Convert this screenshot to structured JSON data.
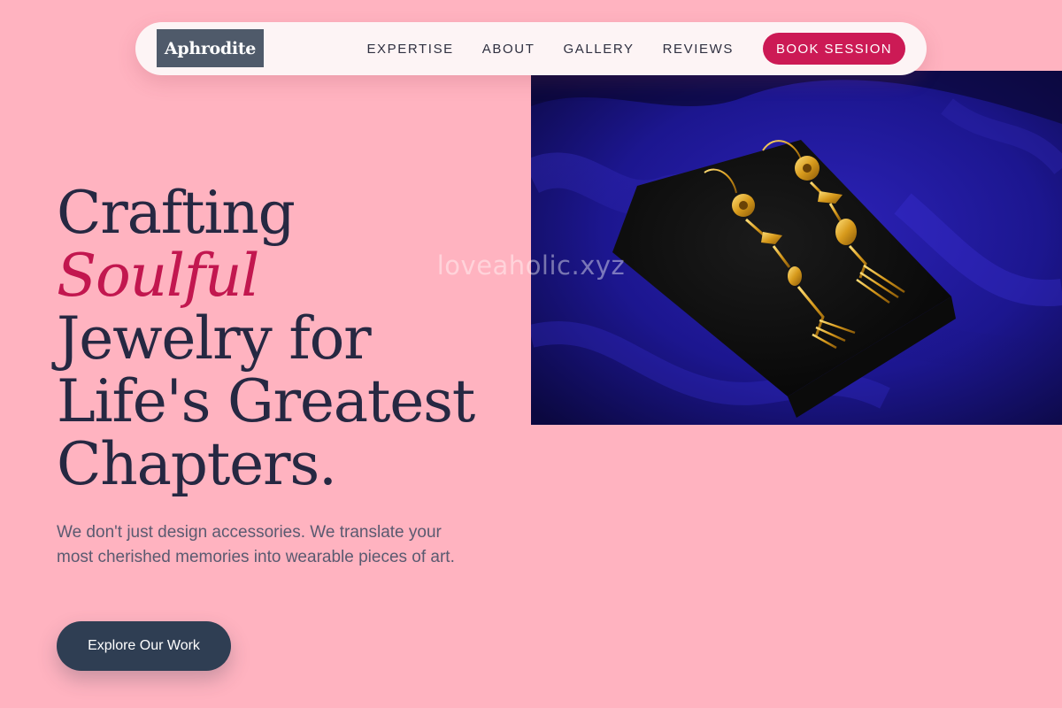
{
  "brand": {
    "logo_text": "Aphrodite"
  },
  "nav": {
    "links": [
      "EXPERTISE",
      "ABOUT",
      "GALLERY",
      "REVIEWS"
    ],
    "cta": "BOOK SESSION"
  },
  "hero": {
    "headline": {
      "line1": "Crafting",
      "accent": "Soulful",
      "line3": "Jewelry for",
      "line4": "Life's Greatest",
      "line5": "Chapters."
    },
    "subtext": "We don't just design accessories. We translate your most cherished memories into wearable pieces of art.",
    "button": "Explore Our Work",
    "image_watermark": "loveaholic.xyz"
  },
  "colors": {
    "page_background": "#ffb3c0",
    "accent": "#cc1a55",
    "logo_background": "#4f5a6a",
    "button_background": "#2f3e53",
    "headline": "#262842"
  }
}
